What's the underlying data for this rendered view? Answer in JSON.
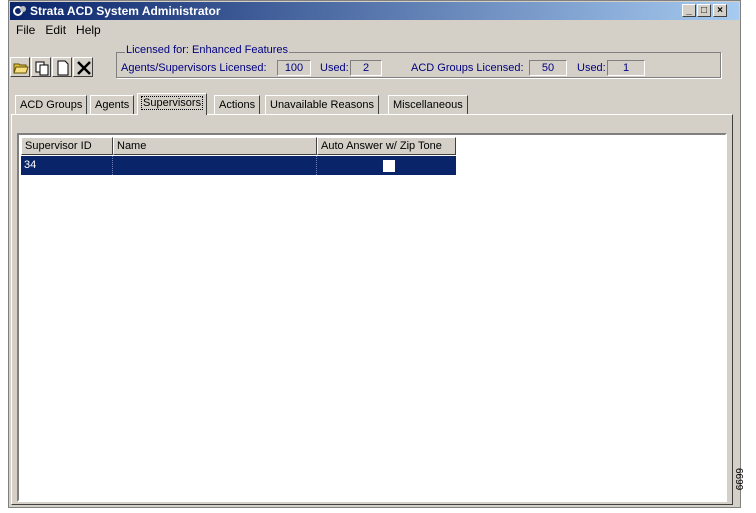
{
  "window": {
    "title": "Strata ACD System Administrator"
  },
  "menu": [
    "File",
    "Edit",
    "Help"
  ],
  "license": {
    "legend": "Licensed for: Enhanced Features",
    "agents_label": "Agents/Supervisors Licensed:",
    "agents_value": "100",
    "used_label_1": "Used:",
    "used_value_1": "2",
    "groups_label": "ACD Groups Licensed:",
    "groups_value": "50",
    "used_label_2": "Used:",
    "used_value_2": "1"
  },
  "tabs": [
    "ACD Groups",
    "Agents",
    "Supervisors",
    "Actions",
    "Unavailable Reasons",
    "Miscellaneous"
  ],
  "active_tab": "Supervisors",
  "table": {
    "columns": [
      "Supervisor ID",
      "Name",
      "Auto Answer w/ Zip Tone"
    ],
    "rows": [
      {
        "supervisor_id": "34",
        "name": "",
        "auto_answer": false
      }
    ]
  },
  "figure_number": "6699"
}
